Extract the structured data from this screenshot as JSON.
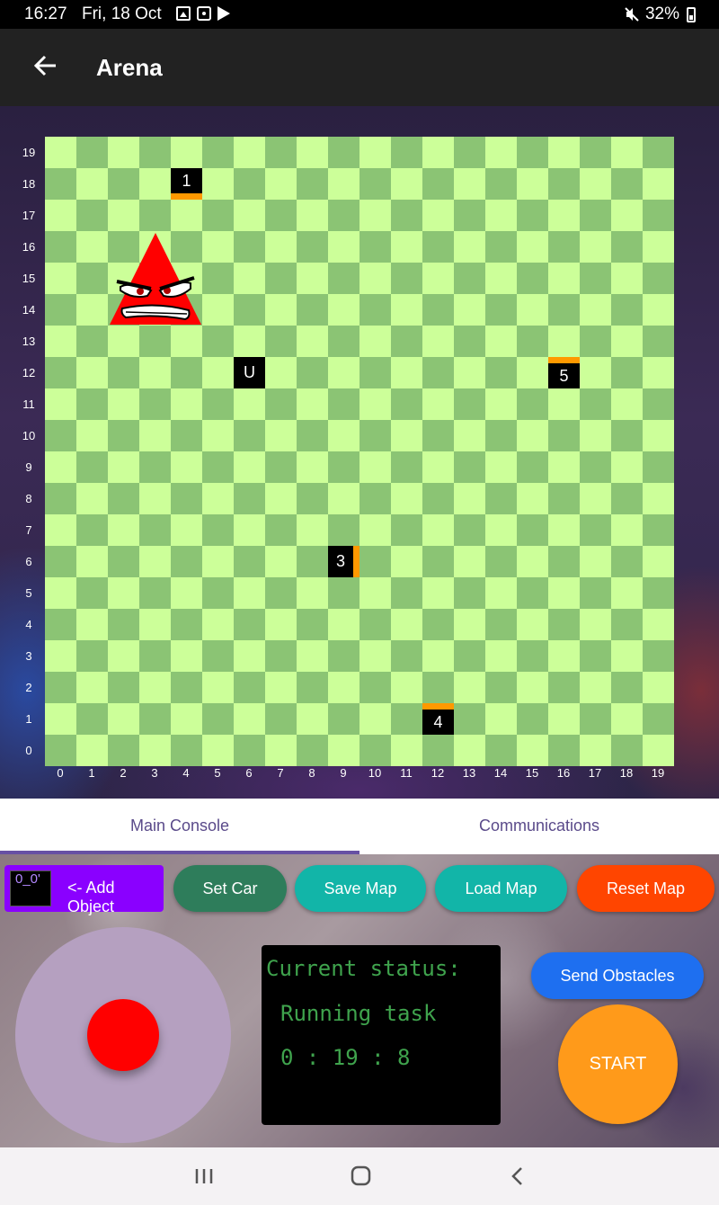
{
  "status_bar": {
    "time": "16:27",
    "date": "Fri, 18 Oct",
    "battery": "32%",
    "icons": [
      "gallery-icon",
      "screen-record-icon",
      "play-store-icon",
      "mute-icon",
      "battery-icon"
    ]
  },
  "app_bar": {
    "title": "Arena",
    "back_icon": "arrow-left-icon"
  },
  "arena": {
    "grid_size": 20,
    "y_labels": [
      "19",
      "18",
      "17",
      "16",
      "15",
      "14",
      "13",
      "12",
      "11",
      "10",
      "9",
      "8",
      "7",
      "6",
      "5",
      "4",
      "3",
      "2",
      "1",
      "0"
    ],
    "x_labels": [
      "0",
      "1",
      "2",
      "3",
      "4",
      "5",
      "6",
      "7",
      "8",
      "9",
      "10",
      "11",
      "12",
      "13",
      "14",
      "15",
      "16",
      "17",
      "18",
      "19"
    ],
    "colors": {
      "light_cell": "#ccff99",
      "dark_cell": "#8bc474",
      "obstacle": "#000000",
      "face_marker": "#ff9900",
      "robot": "#ff0000"
    },
    "obstacles": [
      {
        "label": "1",
        "x": 4,
        "y": 18,
        "face": "S"
      },
      {
        "label": "U",
        "x": 6,
        "y": 12,
        "face": "none"
      },
      {
        "label": "5",
        "x": 16,
        "y": 12,
        "face": "N"
      },
      {
        "label": "3",
        "x": 9,
        "y": 6,
        "face": "E"
      },
      {
        "label": "4",
        "x": 12,
        "y": 1,
        "face": "N"
      }
    ],
    "robot": {
      "x_range": [
        2,
        4
      ],
      "y_range": [
        14,
        16
      ],
      "facing": "N",
      "icon": "angry-triangle-robot-icon"
    }
  },
  "tabs": [
    {
      "label": "Main Console",
      "selected": true
    },
    {
      "label": "Communications",
      "selected": false
    }
  ],
  "controls": {
    "add_object": {
      "swatch_text": "0_0'",
      "label": "<- Add Object",
      "color": "#8a00ff"
    },
    "buttons": [
      {
        "label": "Set Car",
        "color": "#2e7d5b"
      },
      {
        "label": "Save Map",
        "color": "#12b5a8"
      },
      {
        "label": "Load Map",
        "color": "#12b5a8"
      },
      {
        "label": "Reset Map",
        "color": "#ff4500"
      }
    ],
    "send_obstacles": {
      "label": "Send Obstacles",
      "color": "#1e6ff0"
    },
    "start": {
      "label": "START",
      "color": "#ff9a1a"
    }
  },
  "status": {
    "title": "Current status:",
    "task": "Running task",
    "timer": "0 : 19 : 8"
  },
  "nav_bar": {
    "icons": [
      "recent-apps-icon",
      "home-icon",
      "back-icon"
    ]
  }
}
